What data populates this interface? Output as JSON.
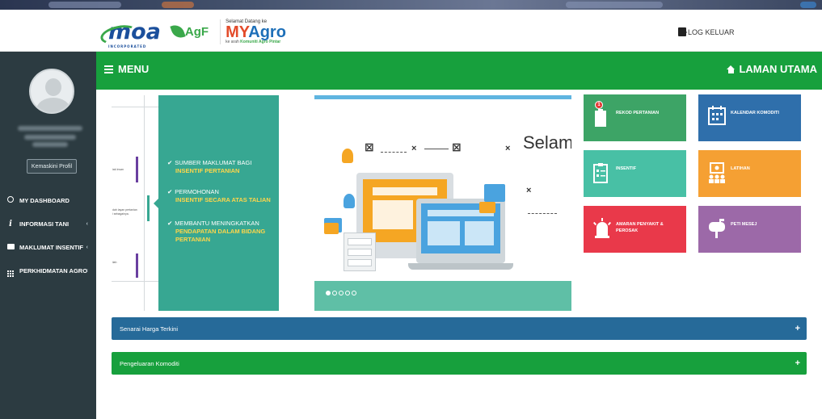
{
  "header": {
    "logo_moa": "moa",
    "logo_moa_sub": "INCORPORATED",
    "logo_agf": "AgF",
    "welcome_line": "Selamat Datang ke",
    "app_name_prefix": "MY",
    "app_name_suffix": "Agro",
    "tagline_prefix": "ke arah",
    "tagline_bold": "Komuniti Agro Pintar",
    "logout_label": "LOG KELUAR"
  },
  "sidebar": {
    "profile_button": "Kemaskini Profil",
    "items": [
      {
        "label": "MY DASHBOARD",
        "icon": "dashboard-icon",
        "has_caret": false
      },
      {
        "label": "INFORMASI TANI",
        "icon": "info-icon",
        "has_caret": true
      },
      {
        "label": "MAKLUMAT INSENTIF",
        "icon": "card-icon",
        "has_caret": true
      },
      {
        "label": "PERKHIDMATAN AGRO",
        "icon": "grid-icon",
        "has_caret": true
      }
    ],
    "caret": "‹"
  },
  "menubar": {
    "menu_label": "MENU",
    "home_label": "LAMAN UTAMA"
  },
  "banner": {
    "left_snippets": [
      "iak Insan",
      "dah layan pertanian\ni sebagainya.",
      "ilah"
    ],
    "items": [
      {
        "line": "SUMBER MAKLUMAT BAGI",
        "highlight": "INSENTIF PERTANIAN"
      },
      {
        "line": "PERMOHONAN",
        "highlight": "INSENTIF SECARA ATAS TALIAN"
      },
      {
        "line": "MEMBANTU MENINGKATKAN",
        "highlight": "PENDAPATAN DALAM BIDANG PERTANIAN"
      }
    ],
    "check": "✔",
    "slide_text": "Selamat",
    "slide_count": 5,
    "active_slide": 1
  },
  "tiles": {
    "rekod": "REKOD PERTANIAN",
    "rekod_badge": "1",
    "kalendar": "KALENDAR KOMODITI",
    "insentif": "INSENTIF",
    "latihan": "LATIHAN",
    "amaran": "AMARAN PENYAKIT & PEROSAK",
    "peti": "PETI MESEJ"
  },
  "accordions": {
    "harga": "Senarai Harga Terkini",
    "komoditi": "Pengeluaran Komoditi",
    "toggle": "+"
  },
  "colors": {
    "green": "#17a03d",
    "sidebar": "#2c3b41",
    "teal": "#37a792",
    "blue": "#266a99",
    "highlight": "#ffd64a"
  }
}
